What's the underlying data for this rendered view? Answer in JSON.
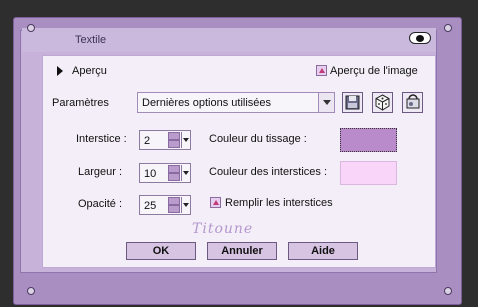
{
  "window": {
    "title": "Textile"
  },
  "preview": {
    "toggle_label": "Aperçu",
    "show_image_label": "Aperçu de l'image",
    "show_image_checked": true
  },
  "params": {
    "label": "Paramètres",
    "selected": "Dernières options utilisées"
  },
  "fields": {
    "interstice": {
      "label": "Interstice :",
      "value": "2"
    },
    "largeur": {
      "label": "Largeur :",
      "value": "10"
    },
    "opacite": {
      "label": "Opacité :",
      "value": "25"
    }
  },
  "colors": {
    "weave_label": "Couleur du tissage :",
    "weave_color": "#b98bcb",
    "gap_label": "Couleur des interstices :",
    "gap_color": "#f9d6f9"
  },
  "fill": {
    "label": "Remplir les interstices",
    "checked": true
  },
  "signature": "Titoune",
  "buttons": {
    "ok": "OK",
    "cancel": "Annuler",
    "help": "Aide"
  }
}
